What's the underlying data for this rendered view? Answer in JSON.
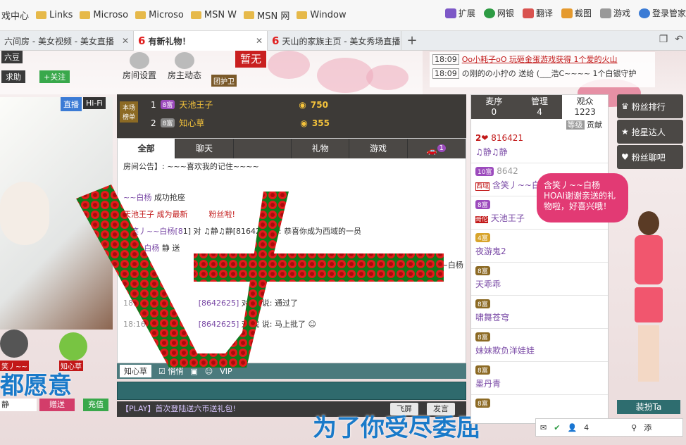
{
  "bookmarks": {
    "items": [
      "戏中心",
      "Links",
      "Microso",
      "Microso",
      "MSN W",
      "MSN 网",
      "Window"
    ],
    "tools": [
      "扩展",
      "网银",
      "翻译",
      "截图",
      "游戏",
      "登录管家"
    ]
  },
  "tabs": [
    {
      "label": "六间房 - 美女视频 - 美女直播"
    },
    {
      "label": "有新礼物！"
    },
    {
      "label": "天山的家族主页 - 美女秀场直播"
    }
  ],
  "room": {
    "beans": "六豆",
    "help": "求助",
    "follow": "+关注",
    "settings": "房间设置",
    "dynamic": "房主动态",
    "none": "暂无",
    "guard": "团护卫",
    "live_tag": "直播",
    "hifi": "Hi-Fi"
  },
  "notices": [
    {
      "time": "18:09",
      "text": "Oo小耗子oO 玩砸金蛋游戏获得 1个爱的火山"
    },
    {
      "time": "18:09",
      "text": "の刚的の小拧の 送给 (___浩C~~~~ 1个白银守护"
    }
  ],
  "rank": {
    "label1": "本场",
    "label2": "榜单",
    "rows": [
      {
        "n": "1",
        "lv": "8富",
        "name": "天池王子",
        "score": "750"
      },
      {
        "n": "2",
        "lv": "8富",
        "name": "知心草",
        "score": "355"
      }
    ]
  },
  "chat": {
    "tabs": [
      "全部",
      "聊天",
      "",
      "礼物",
      "游戏",
      ""
    ],
    "car_count": "1",
    "messages": [
      {
        "pre": "房间公告】: ~~~喜欢我的记",
        "mid": "",
        "post": "住~~~~"
      },
      {
        "pre": "",
        "mid": "~~白杨",
        "post": " 成功抢座"
      },
      {
        "pre": "",
        "mid": "天池王子",
        "post": " 成为最新",
        "tail": "粉丝啦!"
      },
      {
        "pre": "含笑丿~~白杨",
        "mid": "[8",
        "post": "1] 对 ♫静♫静[816421] 说: 恭喜你成为西域的一员"
      },
      {
        "pre": "",
        "mid": "丿~~白杨",
        "post": " 静 送"
      },
      {
        "pre": "",
        "mid": "",
        "post": "玫瑰, 共50个, 感谢 含笑丿~~白杨 的"
      },
      {
        "pre": "热情",
        "mid": "",
        "post": ""
      },
      {
        "time": "18:12",
        "pre": "天",
        "mid": "[8642625]",
        "post": " 对 我 说: 通过了"
      },
      {
        "time": "18:16",
        "pre": "知",
        "mid": "[8642625]",
        "post": " 对 我 说: 马上批了"
      }
    ],
    "target": "知心草",
    "quiet": "悄悄",
    "promo": "【PLAY】首次登陆送六币送礼包!",
    "fly": "飞屏",
    "send": "发言"
  },
  "side": {
    "tabs": [
      {
        "label": "麦序",
        "count": "0"
      },
      {
        "label": "管理",
        "count": "4"
      },
      {
        "label": "观众",
        "count": "1223"
      }
    ],
    "level_tag": "等级",
    "contrib_tag": "贡献",
    "users": [
      {
        "lv": "2",
        "id": "816421",
        "name": "♫静♫静"
      },
      {
        "lv": "10富",
        "id": "8642",
        "name": "含笑丿~~白杨",
        "tag": "西域"
      },
      {
        "lv": "8富",
        "id": "",
        "name": "天池王子",
        "tag": "哥伦"
      },
      {
        "lv": "4富",
        "id": "",
        "name": "夜游鬼2"
      },
      {
        "lv": "8富",
        "id": "",
        "name": "天乖乖"
      },
      {
        "lv": "8富",
        "id": "",
        "name": "啸舞苍穹"
      },
      {
        "lv": "8富",
        "id": "",
        "name": "妹妹欺负洋娃娃"
      },
      {
        "lv": "8富",
        "id": "",
        "name": "墨丹青"
      },
      {
        "lv": "8富",
        "id": "",
        "name": ""
      }
    ]
  },
  "right": {
    "fans_rank": "粉丝排行",
    "seat": "抢星达人",
    "fans_chat": "粉丝聊吧",
    "bubble_name": "含笑丿~~白杨",
    "bubble_text": "HOAI谢谢亲送的礼物啦，好喜兴哦！",
    "dress": "装扮Ta"
  },
  "left_bottom": {
    "name_tag": "笑丿~~",
    "heart": "知心草",
    "nick": "静",
    "gift": "赠送",
    "recharge": "充值"
  },
  "bottom_tools": {
    "count": "4",
    "add": "添"
  },
  "captions": {
    "main": "为了你受尽委屈",
    "left": "都愿意"
  }
}
